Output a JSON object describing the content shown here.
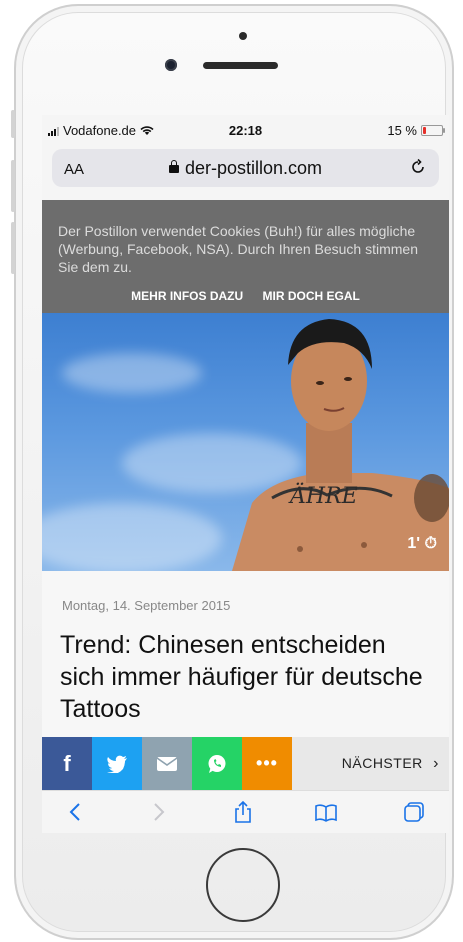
{
  "status_bar": {
    "carrier": "Vodafone.de",
    "time": "22:18",
    "battery_percent": "15 %",
    "battery_level": 0.15
  },
  "url_bar": {
    "text_size_label": "AA",
    "domain": "der-postillon.com"
  },
  "cookie_banner": {
    "text": "Der Postillon verwendet Cookies (Buh!) für alles mögliche (Werbung, Facebook, NSA). Durch Ihren Besuch stimmen Sie dem zu.",
    "more_info_label": "MEHR INFOS DAZU",
    "accept_label": "MIR DOCH EGAL"
  },
  "hero": {
    "tattoo_text": "ÄHRE",
    "read_time": "1'"
  },
  "article": {
    "date": "Montag, 14. September 2015",
    "headline": "Trend: Chinesen entscheiden sich immer häufiger für deutsche Tattoos"
  },
  "share_bar": {
    "buttons": [
      {
        "icon": "facebook-icon",
        "color": "#3b5998"
      },
      {
        "icon": "twitter-icon",
        "color": "#1da1f2"
      },
      {
        "icon": "mail-icon",
        "color": "#8fa3b0"
      },
      {
        "icon": "whatsapp-icon",
        "color": "#25d366"
      },
      {
        "icon": "more-icon",
        "color": "#f08c00"
      }
    ],
    "next_label": "NÄCHSTER"
  },
  "toolbar": {
    "icons": [
      "back-icon",
      "forward-icon",
      "share-icon",
      "bookmarks-icon",
      "tabs-icon"
    ]
  }
}
